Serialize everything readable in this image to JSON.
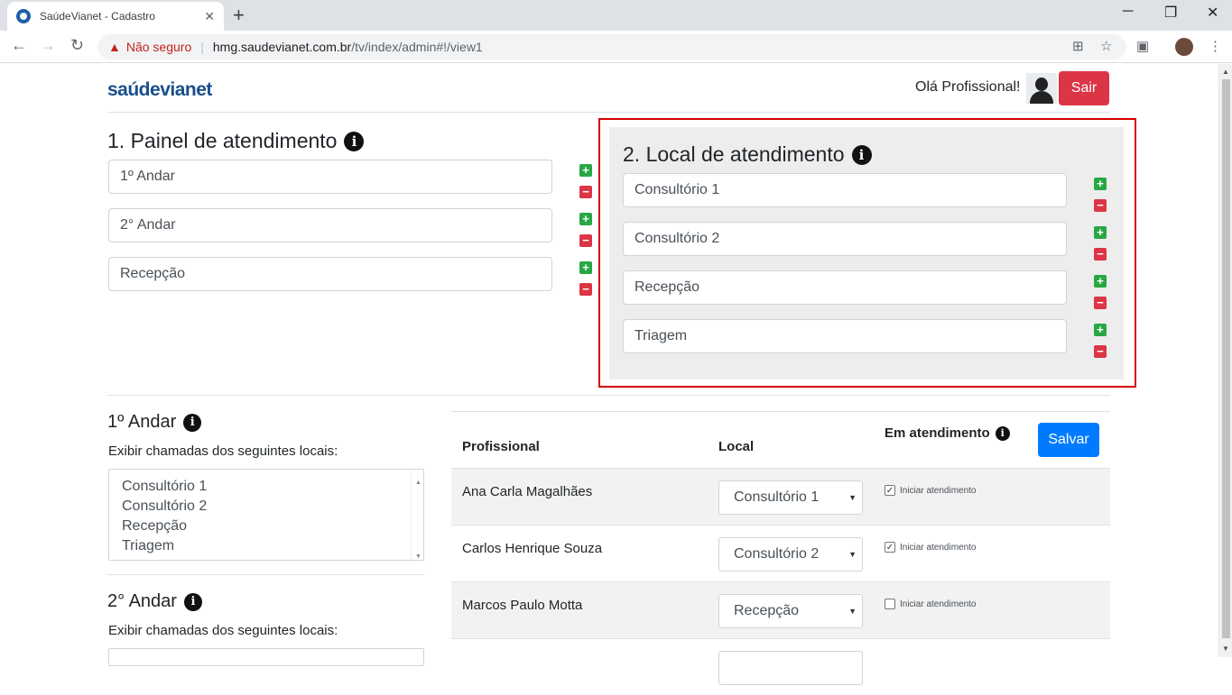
{
  "browser": {
    "tab_title": "SaúdeVianet - Cadastro",
    "tab_close": "✕",
    "new_tab": "+",
    "not_secure": "Não seguro",
    "url_host": "hmg.saudevianet.com.br",
    "url_path": "/tv/index/admin#!/view1"
  },
  "header": {
    "logo": "saúdevianet",
    "greeting": "Olá Profissional!",
    "logout_label": "Sair"
  },
  "painel": {
    "title": "1. Painel de atendimento",
    "items": [
      "1º Andar",
      "2° Andar",
      "Recepção"
    ]
  },
  "local": {
    "title": "2. Local de atendimento",
    "items": [
      "Consultório 1",
      "Consultório 2",
      "Recepção",
      "Triagem"
    ]
  },
  "floors": [
    {
      "title": "1º Andar",
      "label": "Exibir chamadas dos seguintes locais:",
      "locais": [
        "Consultório 1",
        "Consultório 2",
        "Recepção",
        "Triagem"
      ]
    },
    {
      "title": "2° Andar",
      "label": "Exibir chamadas dos seguintes locais:"
    }
  ],
  "table": {
    "col_profissional": "Profissional",
    "col_local": "Local",
    "col_atendimento": "Em atendimento",
    "save_label": "Salvar",
    "checkbox_label": "Iniciar atendimento",
    "rows": [
      {
        "name": "Ana Carla Magalhães",
        "local": "Consultório 1",
        "checked": true
      },
      {
        "name": "Carlos Henrique Souza",
        "local": "Consultório 2",
        "checked": true
      },
      {
        "name": "Marcos Paulo Motta",
        "local": "Recepção",
        "checked": false
      }
    ]
  },
  "colors": {
    "brand": "#1a4e8a",
    "danger": "#dc3545",
    "primary": "#007bff",
    "success": "#28a745",
    "highlight": "#d40000"
  }
}
